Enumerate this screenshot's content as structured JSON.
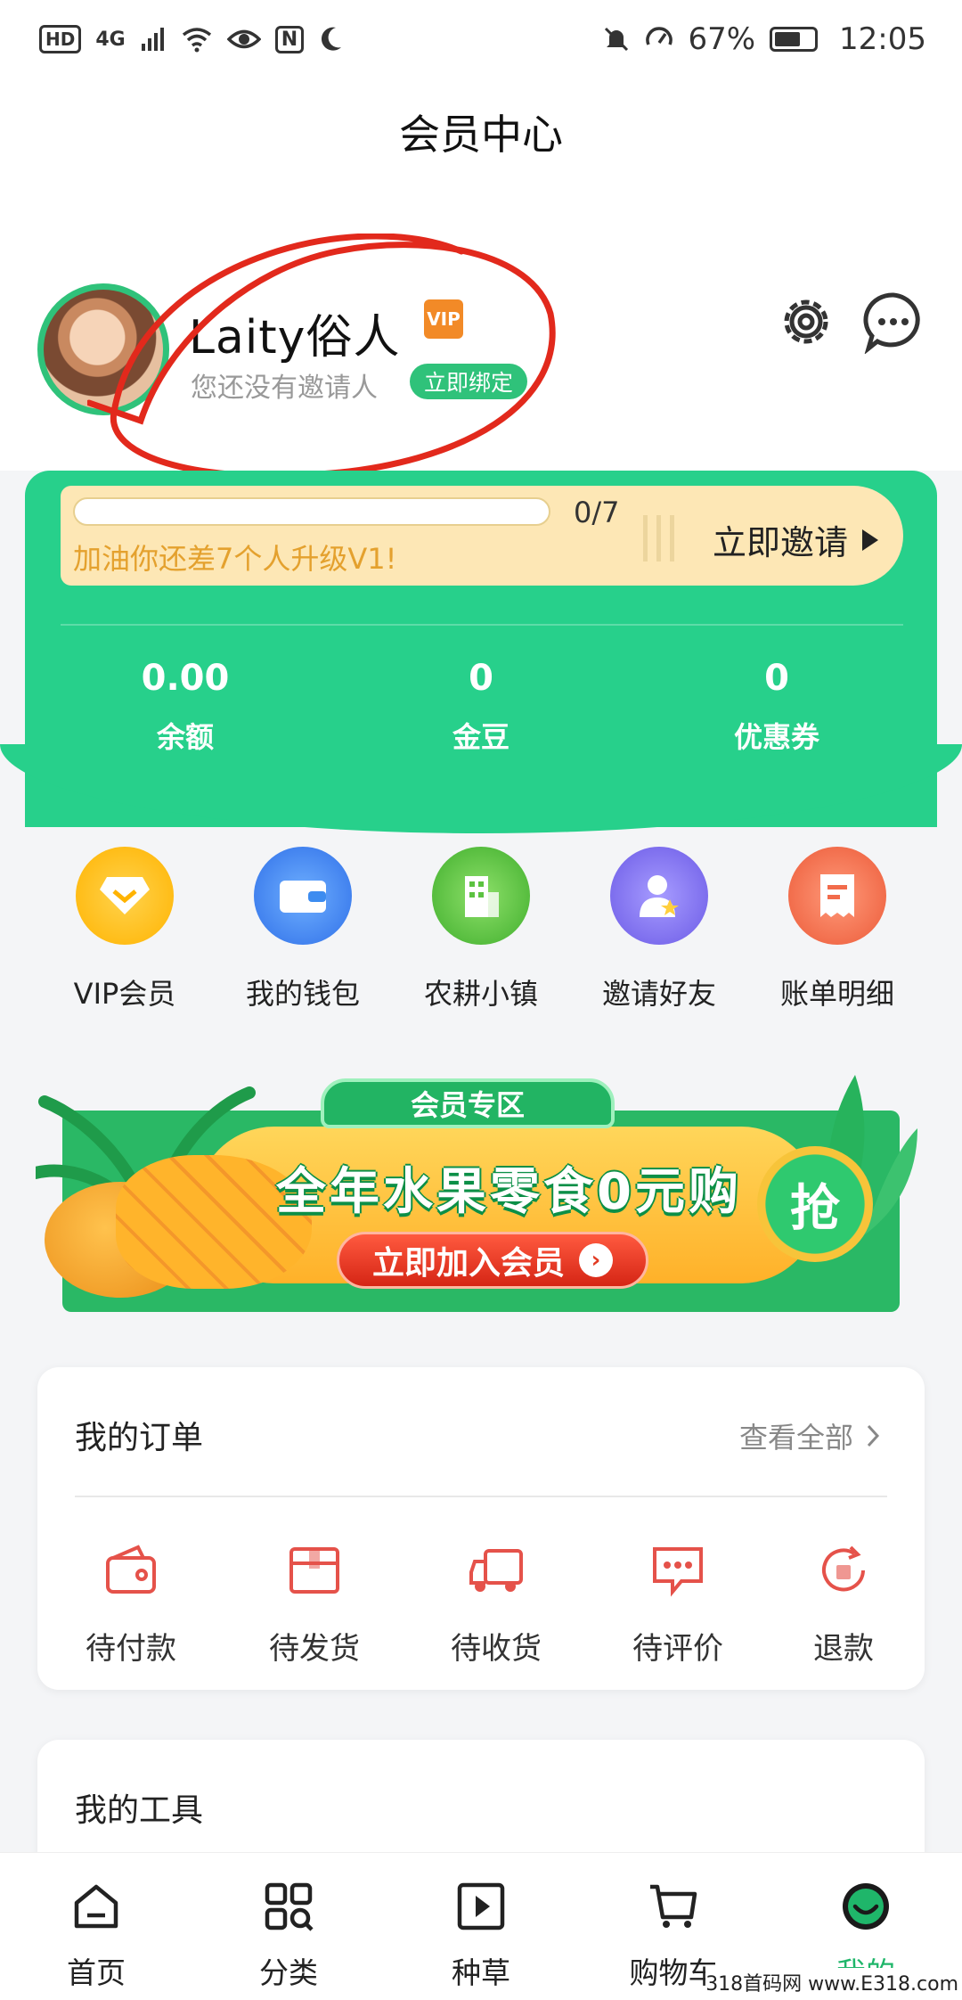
{
  "status_bar": {
    "hd": "HD",
    "network": "4G",
    "nfc": "N",
    "battery": "67%",
    "battery_fraction": 0.67,
    "time": "12:05"
  },
  "header": {
    "title": "会员中心"
  },
  "profile": {
    "username": "Laity俗人",
    "vip_label": "VIP",
    "inviter_text": "您还没有邀请人",
    "bind_button": "立即绑定"
  },
  "upgrade": {
    "count": "0/7",
    "progress": 0,
    "tip": "加油你还差7个人升级V1!",
    "invite_button": "立即邀请"
  },
  "stats": [
    {
      "value": "0.00",
      "label": "余额"
    },
    {
      "value": "0",
      "label": "金豆"
    },
    {
      "value": "0",
      "label": "优惠券"
    }
  ],
  "quick_actions": [
    {
      "label": "VIP会员",
      "icon": "vip-diamond-icon",
      "color": "#ffbf1f"
    },
    {
      "label": "我的钱包",
      "icon": "wallet-icon",
      "color": "#3d8cf0"
    },
    {
      "label": "农耕小镇",
      "icon": "building-icon",
      "color": "#5cc241"
    },
    {
      "label": "邀请好友",
      "icon": "invite-friend-icon",
      "color": "#7c6cf0"
    },
    {
      "label": "账单明细",
      "icon": "bill-icon",
      "color": "#f26b4b"
    }
  ],
  "banner": {
    "tag": "会员专区",
    "title": "全年水果零食0元购",
    "cta": "立即加入会员",
    "grab": "抢"
  },
  "orders": {
    "title": "我的订单",
    "view_all": "查看全部",
    "items": [
      {
        "label": "待付款",
        "icon": "wallet-pay-icon"
      },
      {
        "label": "待发货",
        "icon": "package-icon"
      },
      {
        "label": "待收货",
        "icon": "truck-icon"
      },
      {
        "label": "待评价",
        "icon": "comment-icon"
      },
      {
        "label": "退款",
        "icon": "refund-icon"
      }
    ]
  },
  "tools": {
    "title": "我的工具"
  },
  "bottom_nav": [
    {
      "label": "首页",
      "icon": "home-icon"
    },
    {
      "label": "分类",
      "icon": "category-icon"
    },
    {
      "label": "种草",
      "icon": "play-icon"
    },
    {
      "label": "购物车",
      "icon": "cart-icon"
    },
    {
      "label": "我的",
      "icon": "profile-smile-icon",
      "active": true
    }
  ],
  "watermark": "318首码网 www.E318.com",
  "colors": {
    "brand_green": "#27d08b",
    "active_green": "#1fb66a",
    "accent_orange": "#f28a27"
  }
}
